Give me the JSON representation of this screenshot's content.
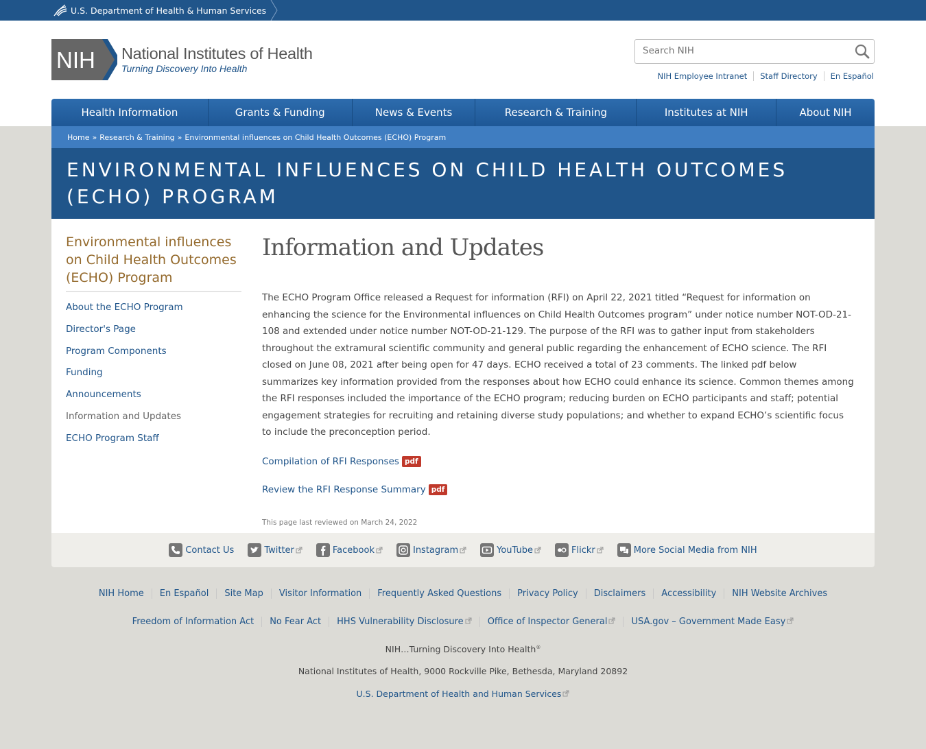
{
  "hhs_bar": {
    "text": "U.S. Department of Health & Human Services"
  },
  "logo": {
    "abbr": "NIH",
    "name": "National Institutes of Health",
    "tagline": "Turning Discovery Into Health"
  },
  "search": {
    "placeholder": "Search NIH"
  },
  "utility_links": [
    "NIH Employee Intranet",
    "Staff Directory",
    "En Español"
  ],
  "nav": [
    "Health Information",
    "Grants & Funding",
    "News & Events",
    "Research & Training",
    "Institutes at NIH",
    "About NIH"
  ],
  "breadcrumb": [
    "Home",
    "Research & Training",
    "Environmental influences on Child Health Outcomes (ECHO) Program"
  ],
  "breadcrumb_separator": "»",
  "banner_title": "ENVIRONMENTAL INFLUENCES ON CHILD HEALTH OUTCOMES (ECHO) PROGRAM",
  "sidenav": {
    "title": "Environmental influences on Child Health Outcomes (ECHO) Program",
    "items": [
      "About the ECHO Program",
      "Director's Page",
      "Program Components",
      "Funding",
      "Announcements",
      "Information and Updates",
      "ECHO Program Staff"
    ],
    "current": "Information and Updates"
  },
  "main": {
    "heading": "Information and Updates",
    "body": "The ECHO Program Office released a Request for information (RFI) on April 22, 2021 titled “Request for information on enhancing the science for the Environmental influences on Child Health Outcomes program” under notice number NOT-OD-21-108 and extended under notice number NOT-OD-21-129. The purpose of the RFI was to gather input from stakeholders throughout the extramural scientific community and general public regarding the enhancement of ECHO science. The RFI closed on June 08, 2021 after being open for 47 days. ECHO received a total of 23 comments. The linked pdf below summarizes key information provided from the responses about how ECHO could enhance its science. Common themes among the RFI responses included the importance of the ECHO program; reducing burden on ECHO participants and staff; potential engagement strategies for recruiting and retaining diverse study populations; and whether to expand ECHO’s scientific focus to include the preconception period.",
    "links": [
      {
        "label": "Compilation of RFI Responses",
        "badge": "pdf"
      },
      {
        "label": "Review the RFI Response Summary",
        "badge": "pdf"
      }
    ],
    "reviewed": "This page last reviewed on March 24, 2022"
  },
  "social": [
    {
      "label": "Contact Us",
      "icon": "phone-icon",
      "external": false
    },
    {
      "label": "Twitter",
      "icon": "twitter-icon",
      "external": true
    },
    {
      "label": "Facebook",
      "icon": "facebook-icon",
      "external": true
    },
    {
      "label": "Instagram",
      "icon": "instagram-icon",
      "external": true
    },
    {
      "label": "YouTube",
      "icon": "youtube-icon",
      "external": true
    },
    {
      "label": "Flickr",
      "icon": "flickr-icon",
      "external": true
    },
    {
      "label": "More Social Media from NIH",
      "icon": "chat-icon",
      "external": false
    }
  ],
  "footer": {
    "row1": [
      "NIH Home",
      "En Español",
      "Site Map",
      "Visitor Information",
      "Frequently Asked Questions",
      "Privacy Policy",
      "Disclaimers",
      "Accessibility",
      "NIH Website Archives"
    ],
    "row2": [
      {
        "label": "Freedom of Information Act",
        "external": false
      },
      {
        "label": "No Fear Act",
        "external": false
      },
      {
        "label": "HHS Vulnerability Disclosure",
        "external": true
      },
      {
        "label": "Office of Inspector General",
        "external": true
      },
      {
        "label": "USA.gov – Government Made Easy",
        "external": true
      }
    ],
    "tagline": "NIH…Turning Discovery Into Health",
    "tagline_mark": "®",
    "address": "National Institutes of Health, 9000 Rockville Pike, Bethesda, Maryland 20892",
    "hhs_link": "U.S. Department of Health and Human Services"
  },
  "colors": {
    "primary_blue": "#20558a",
    "breadcrumb_blue": "#3f7dc1",
    "sidenav_title": "#946a2d",
    "pdf_badge": "#c0392b"
  }
}
